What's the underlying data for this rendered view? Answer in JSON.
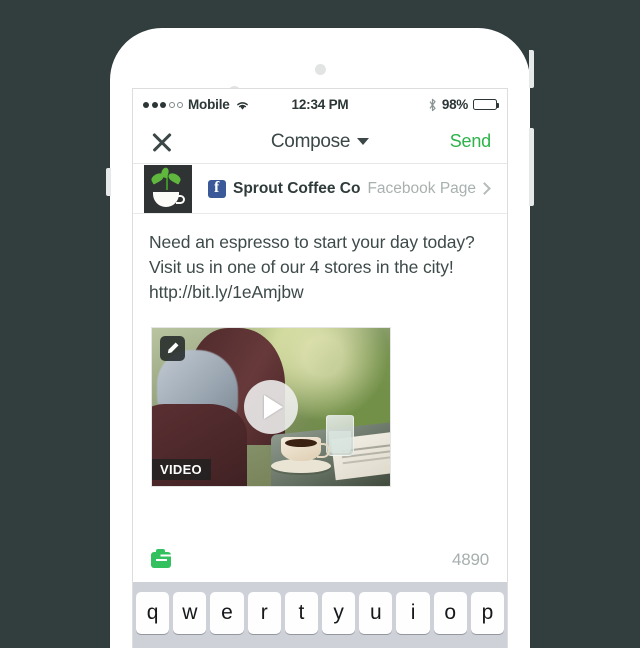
{
  "status_bar": {
    "signal_filled": 3,
    "signal_empty": 2,
    "carrier": "Mobile",
    "wifi_icon": "wifi-icon",
    "time": "12:34 PM",
    "bluetooth_icon": "bluetooth-icon",
    "battery_percent": "98%"
  },
  "nav": {
    "close_icon": "close-icon",
    "title": "Compose",
    "caret_icon": "chevron-down-icon",
    "send_label": "Send"
  },
  "profile": {
    "avatar_icon": "coffee-sprout-avatar",
    "network_icon": "facebook-icon",
    "name": "Sprout Coffee Co",
    "type": "Facebook Page",
    "chevron_icon": "chevron-right-icon"
  },
  "compose": {
    "text": "Need an espresso to start your day today? Visit us in one of our 4 stores in the city! http://bit.ly/1eAmjbw"
  },
  "media": {
    "edit_icon": "pencil-icon",
    "play_icon": "play-icon",
    "type_label": "VIDEO"
  },
  "toolbar": {
    "add_media_icon": "camera-plus-icon",
    "char_count": "4890"
  },
  "keyboard": {
    "row1": [
      "q",
      "w",
      "e",
      "r",
      "t",
      "y",
      "u",
      "i",
      "o",
      "p"
    ]
  },
  "colors": {
    "backdrop": "#323e3e",
    "accent_green": "#2cb34a",
    "add_media_green": "#33c15f",
    "facebook_blue": "#3b5998",
    "text_primary": "#3e4a4a",
    "text_muted": "#a8b0b0"
  }
}
